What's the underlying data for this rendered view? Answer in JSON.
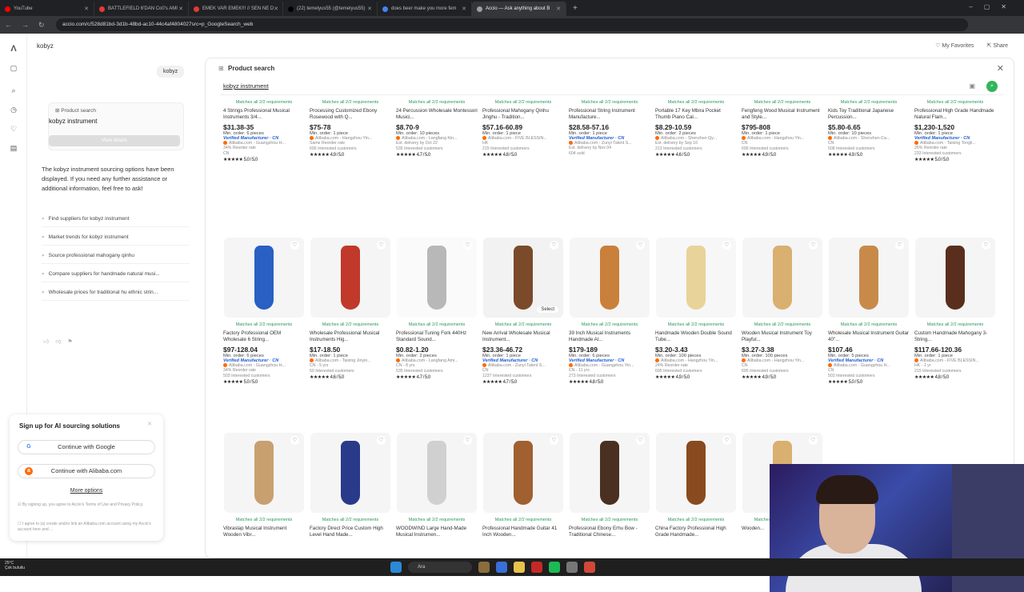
{
  "browser": {
    "tabs": [
      {
        "title": "YouTube",
        "color": "#ff0000",
        "active": false
      },
      {
        "title": "BATTLEFIELD 6'DAN Co0's AMI",
        "color": "#e53935",
        "active": false
      },
      {
        "title": "EMEK VAR EMEK!!! // SEN NE D",
        "color": "#e53935",
        "active": false
      },
      {
        "title": "(22) temelyus55 (@temelyus55)",
        "color": "#222222",
        "active": false
      },
      {
        "title": "does beer make you more fem",
        "color": "#4285f4",
        "active": false
      },
      {
        "title": "Accio — Ask anything about B",
        "color": "#9aa0a6",
        "active": true
      }
    ],
    "url": "accio.com/c/528d81bd-3d1b-48bd-ac10-44c4af4804027src=p_GoogleSearch_web"
  },
  "app": {
    "title": "kobyz",
    "my_favorites": "My Favorites",
    "share": "Share",
    "query_chip": "kobyz",
    "product_search_card": {
      "header": "Product search",
      "term": "kobyz instrument",
      "button": "View details"
    },
    "reply": "The kobyz instrument sourcing options have been displayed. If you need any further assistance or additional information, feel free to ask!",
    "suggestions": [
      "Find suppliers for kobyz instrument",
      "Market trends for kobyz instrument",
      "Source professional mahogany qinhu",
      "Compare suppliers for handmade natural musi...",
      "Wholesale prices for traditional hu ethnic strin..."
    ]
  },
  "signup": {
    "title": "Sign up for AI sourcing solutions",
    "google": "Continue with Google",
    "alibaba": "Continue with Alibaba.com",
    "more": "More options",
    "terms1": "By signing up, you agree to Accio's Terms of Use and Privacy Policy.",
    "terms2": "I agree to (a) create and/or link an Alibaba.com account using my Accio's account here and ...",
    "more_link": "More"
  },
  "panel": {
    "title": "Product search",
    "query": "kobyz instrument",
    "match_label": "Matches all 2/2 requirements",
    "row1": [
      {
        "title": "4 Strings Professional Musical Instruments 3/4...",
        "price": "$31.38-35",
        "moq": "Min. order: 6 pieces",
        "verified": true,
        "supplier": "Alibaba.com - Guangzhou H...",
        "meta1": "34% Reorder rate",
        "meta2": "CN",
        "rating": "5.0 / 5.0"
      },
      {
        "title": "Processing Customized Ebony Rosewood with Q...",
        "price": "$75-78",
        "moq": "Min. order: 1 piece",
        "verified": false,
        "supplier": "Alibaba.com - Hangzhou Yin...",
        "meta1": "Same Reorder rate",
        "meta2": "695 Interested customers",
        "rating": "4.9 / 5.0"
      },
      {
        "title": "24 Percussion Wholesale Montessori Musici...",
        "price": "$8.70-9",
        "moq": "Min. order: 10 pieces",
        "verified": false,
        "supplier": "Alibaba.com - Langfang Kin...",
        "meta1": "Est. delivery by Oct 22",
        "meta2": "535 Interested customers",
        "rating": "4.7 / 5.0"
      },
      {
        "title": "Professional Mahogany Qinhu Jinghu - Tradition...",
        "price": "$57.16-60.89",
        "moq": "Min. order: 1 piece",
        "verified": false,
        "supplier": "Alibaba.com - FIVE BLESSIN...",
        "meta1": "HK",
        "meta2": "215 Interested customers",
        "rating": "4.8 / 5.0"
      },
      {
        "title": "Professional String Instrument Manufacture...",
        "price": "$28.58-57.16",
        "moq": "Min. order: 1 piece",
        "verified": true,
        "supplier": "Alibaba.com - Zunyi Talent S...",
        "meta1": "Est. delivery by Nov 04",
        "meta2": "604 sold",
        "rating": ""
      },
      {
        "title": "Portable 17 Key Mbira Pocket Thumb Piano Cal...",
        "price": "$8.29-10.59",
        "moq": "Min. order: 2 pieces",
        "verified": false,
        "supplier": "Alibaba.com - Shenzhen Qy...",
        "meta1": "Est. delivery by Sep 10",
        "meta2": "213 Interested customers",
        "rating": "4.6 / 5.0"
      },
      {
        "title": "Fengfeng Wood Musical Instrument and Style...",
        "price": "$795-808",
        "moq": "Min. order: 1 piece",
        "verified": false,
        "supplier": "Alibaba.com - Hangzhou Yin...",
        "meta1": "CN",
        "meta2": "695 Interested customers",
        "rating": "4.9 / 5.0"
      },
      {
        "title": "Kids Toy Traditional Japanese Percussion...",
        "price": "$5.80-6.65",
        "moq": "Min. order: 10 pieces",
        "verified": false,
        "supplier": "Alibaba.com - Shenzhen Ca...",
        "meta1": "CN",
        "meta2": "508 Interested customers",
        "rating": "4.9 / 5.0"
      },
      {
        "title": "Professional High Grade Handmade Natural Flam...",
        "price": "$1,230-1,520",
        "moq": "Min. order: 1 piece",
        "verified": true,
        "supplier": "Alibaba.com - Taixing Tongli...",
        "meta1": "26% Reorder rate",
        "meta2": "233 Interested customers",
        "rating": "5.0 / 5.0"
      }
    ],
    "row2": [
      {
        "title": "Factory Professional OEM Wholesale 6 String...",
        "price": "$97-128.04",
        "moq": "Min. order: 6 pieces",
        "verified": true,
        "supplier": "Alibaba.com - Guangzhou H...",
        "meta1": "34% Reorder rate",
        "meta2": "503 Interested customers",
        "rating": "5.0 / 5.0"
      },
      {
        "title": "Wholesale Professional Musical Instruments Hig...",
        "price": "$17-18.50",
        "moq": "Min. order: 1 piece",
        "verified": false,
        "supplier": "Alibaba.com - Taixing Jinyin...",
        "meta1": "CN - 5 yrs",
        "meta2": "50 Interested customers",
        "rating": "4.6 / 5.0"
      },
      {
        "title": "Professional Tuning Fork 440Hz Standard Sound...",
        "price": "$0.82-1.20",
        "moq": "Min. order: 2 pieces",
        "verified": false,
        "supplier": "Alibaba.com - Langfang Ami...",
        "meta1": "CN - 8 yrs",
        "meta2": "535 Interested customers",
        "rating": "4.7 / 5.0"
      },
      {
        "title": "New Arrival Wholesale Musical Instrument...",
        "price": "$23.36-46.72",
        "moq": "Min. order: 1 piece",
        "verified": true,
        "supplier": "Alibaba.com - Zunyi Talent S...",
        "meta1": "CN",
        "meta2": "1237 Interested customers",
        "rating": "4.7 / 5.0"
      },
      {
        "title": "39 Inch Musical Instruments Handmade Al...",
        "price": "$179-189",
        "moq": "Min. order: 6 pieces",
        "verified": true,
        "supplier": "Alibaba.com - Guangzhou Yin...",
        "meta1": "CN - 11 yrs",
        "meta2": "273 Interested customers",
        "rating": "4.8 / 5.0"
      },
      {
        "title": "Handmade Wooden Double Sound Tube...",
        "price": "$3.20-3.43",
        "moq": "Min. order: 100 pieces",
        "verified": false,
        "supplier": "Alibaba.com - Hangzhou Yin...",
        "meta1": "24% Reorder rate",
        "meta2": "695 Interested customers",
        "rating": "4.9 / 5.0"
      },
      {
        "title": "Wooden Musical Instrument Toy Playful...",
        "price": "$3.27-3.38",
        "moq": "Min. order: 100 pieces",
        "verified": false,
        "supplier": "Alibaba.com - Hangzhou Yin...",
        "meta1": "CN",
        "meta2": "695 Interested customers",
        "rating": "4.9 / 5.0"
      },
      {
        "title": "Wholesale Musical Instrument Guitar 40\"...",
        "price": "$107.46",
        "moq": "Min. order: 5 pieces",
        "verified": true,
        "supplier": "Alibaba.com - Guangzhou H...",
        "meta1": "CN",
        "meta2": "503 Interested customers",
        "rating": "5.0 / 5.0"
      },
      {
        "title": "Custom Handmade Mahogany 3-String...",
        "price": "$117.66-120.36",
        "moq": "Min. order: 1 piece",
        "verified": false,
        "supplier": "Alibaba.com - FIVE BLESSIN...",
        "meta1": "HK - 1 yr",
        "meta2": "215 Interested customers",
        "rating": "4.8 / 5.0"
      }
    ],
    "row3": [
      {
        "title": "Vibraslap Musical Instrument Wooden Vibr..."
      },
      {
        "title": "Factory Direct Price Custom High Level Hand Made..."
      },
      {
        "title": "WOODWIND Large Hand-Made Musical Instrumen..."
      },
      {
        "title": "Professional Handmade Guitar 41 Inch Wooden..."
      },
      {
        "title": "Professional Ebony Erhu Bow - Traditional Chinese..."
      },
      {
        "title": "China Factory Professional High Grade Handmade..."
      },
      {
        "title": "Wooden..."
      }
    ],
    "select_label": "Select"
  },
  "taskbar": {
    "weather_temp": "25°C",
    "weather_desc": "Çok bulutlu",
    "search": "Ara"
  },
  "colors": {
    "match": "#2a9a5a",
    "accent": "#33b55c",
    "verified": "#1f5bd6",
    "alibaba": "#ff6a00"
  }
}
